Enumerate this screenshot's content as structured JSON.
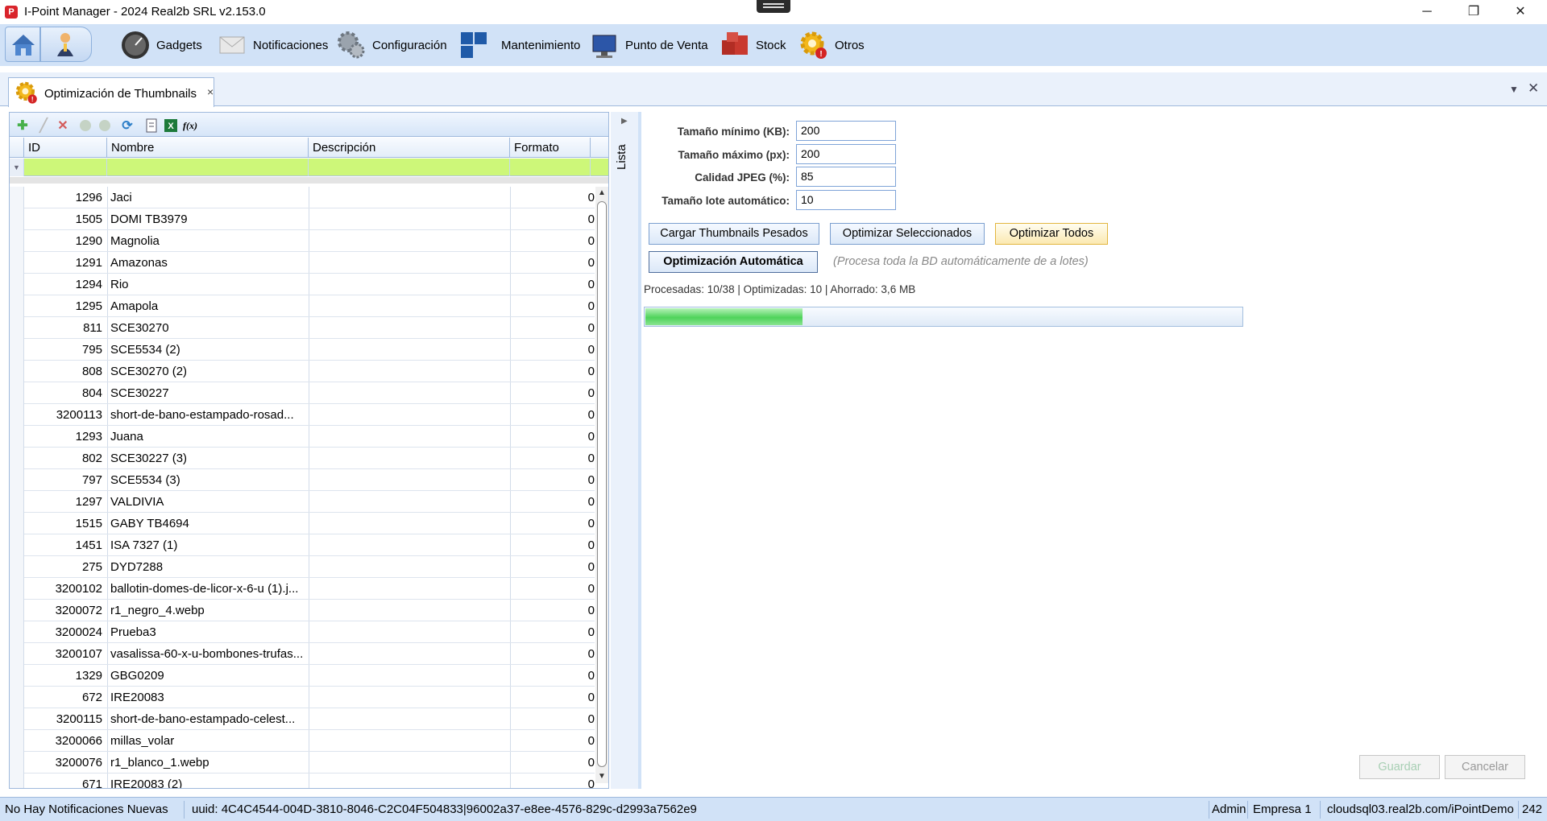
{
  "window": {
    "title": "I-Point Manager - 2024 Real2b SRL v2.153.0",
    "app_icon_letter": "P",
    "minimize": "─",
    "restore": "❐",
    "close": "✕"
  },
  "ribbon": {
    "items": [
      {
        "label": "Gadgets",
        "icon": "gauge-icon"
      },
      {
        "label": "Notificaciones",
        "icon": "envelope-icon"
      },
      {
        "label": "Configuración",
        "icon": "gears-icon"
      },
      {
        "label": "Mantenimiento",
        "icon": "tiles-icon"
      },
      {
        "label": "Punto de Venta",
        "icon": "monitor-icon"
      },
      {
        "label": "Stock",
        "icon": "boxes-icon"
      },
      {
        "label": "Otros",
        "icon": "gear-alert-icon"
      }
    ]
  },
  "tab": {
    "label": "Optimización de Thumbnails",
    "close": "×",
    "menu_glyph": "▼",
    "close_glyph": "✕"
  },
  "grid": {
    "toolbar": [
      "add-icon",
      "edit-icon",
      "delete-icon",
      "prev-icon",
      "next-icon",
      "refresh-icon",
      "export-icon",
      "excel-icon",
      "formula-icon"
    ],
    "columns": {
      "id": "ID",
      "name": "Nombre",
      "description": "Descripción",
      "format": "Formato"
    },
    "rows": [
      {
        "id": "1296",
        "name": "Jaci",
        "desc": "",
        "fmt": "0"
      },
      {
        "id": "1505",
        "name": "DOMI TB3979",
        "desc": "",
        "fmt": "0"
      },
      {
        "id": "1290",
        "name": "Magnolia",
        "desc": "",
        "fmt": "0"
      },
      {
        "id": "1291",
        "name": "Amazonas",
        "desc": "",
        "fmt": "0"
      },
      {
        "id": "1294",
        "name": "Rio",
        "desc": "",
        "fmt": "0"
      },
      {
        "id": "1295",
        "name": "Amapola",
        "desc": "",
        "fmt": "0"
      },
      {
        "id": "811",
        "name": "SCE30270",
        "desc": "",
        "fmt": "0"
      },
      {
        "id": "795",
        "name": "SCE5534 (2)",
        "desc": "",
        "fmt": "0"
      },
      {
        "id": "808",
        "name": "SCE30270 (2)",
        "desc": "",
        "fmt": "0"
      },
      {
        "id": "804",
        "name": "SCE30227",
        "desc": "",
        "fmt": "0"
      },
      {
        "id": "3200113",
        "name": "short-de-bano-estampado-rosad...",
        "desc": "",
        "fmt": "0"
      },
      {
        "id": "1293",
        "name": "Juana",
        "desc": "",
        "fmt": "0"
      },
      {
        "id": "802",
        "name": "SCE30227 (3)",
        "desc": "",
        "fmt": "0"
      },
      {
        "id": "797",
        "name": "SCE5534 (3)",
        "desc": "",
        "fmt": "0"
      },
      {
        "id": "1297",
        "name": "VALDIVIA",
        "desc": "",
        "fmt": "0"
      },
      {
        "id": "1515",
        "name": "GABY TB4694",
        "desc": "",
        "fmt": "0"
      },
      {
        "id": "1451",
        "name": "ISA 7327 (1)",
        "desc": "",
        "fmt": "0"
      },
      {
        "id": "275",
        "name": "DYD7288",
        "desc": "",
        "fmt": "0"
      },
      {
        "id": "3200102",
        "name": "ballotin-domes-de-licor-x-6-u (1).j...",
        "desc": "",
        "fmt": "0"
      },
      {
        "id": "3200072",
        "name": "r1_negro_4.webp",
        "desc": "",
        "fmt": "0"
      },
      {
        "id": "3200024",
        "name": "Prueba3",
        "desc": "",
        "fmt": "0"
      },
      {
        "id": "3200107",
        "name": "vasalissa-60-x-u-bombones-trufas...",
        "desc": "",
        "fmt": "0"
      },
      {
        "id": "1329",
        "name": "GBG0209",
        "desc": "",
        "fmt": "0"
      },
      {
        "id": "672",
        "name": "IRE20083",
        "desc": "",
        "fmt": "0"
      },
      {
        "id": "3200115",
        "name": "short-de-bano-estampado-celest...",
        "desc": "",
        "fmt": "0"
      },
      {
        "id": "3200066",
        "name": "millas_volar",
        "desc": "",
        "fmt": "0"
      },
      {
        "id": "3200076",
        "name": "r1_blanco_1.webp",
        "desc": "",
        "fmt": "0"
      },
      {
        "id": "671",
        "name": "IRE20083 (2)",
        "desc": "",
        "fmt": "0"
      }
    ]
  },
  "side_pane": {
    "label": "Lista",
    "arrow": "▶"
  },
  "form": {
    "min_size_label": "Tamaño mínimo (KB):",
    "min_size_value": "200",
    "max_size_label": "Tamaño máximo (px):",
    "max_size_value": "200",
    "jpeg_quality_label": "Calidad JPEG (%):",
    "jpeg_quality_value": "85",
    "batch_size_label": "Tamaño lote automático:",
    "batch_size_value": "10",
    "load_button": "Cargar Thumbnails Pesados",
    "optimize_selected_button": "Optimizar Seleccionados",
    "optimize_all_button": "Optimizar Todos",
    "auto_button": "Optimización Automática",
    "auto_hint": "(Procesa toda la BD automáticamente de a lotes)",
    "status": "Procesadas: 10/38 | Optimizadas: 10 | Ahorrado: 3,6 MB",
    "progress_fraction": 0.263,
    "save_button": "Guardar",
    "cancel_button": "Cancelar"
  },
  "statusbar": {
    "notifications": "No Hay Notificaciones Nuevas",
    "uuid": "uuid: 4C4C4544-004D-3810-8046-C2C04F504833|96002a37-e8ee-4576-829c-d2993a7562e9",
    "user": "Admin",
    "company": "Empresa 1",
    "server": "cloudsql03.real2b.com/iPointDemo",
    "extra": "242"
  },
  "colors": {
    "ribbon_bg": "#d1e2f7",
    "filter_row": "#cdf779",
    "progress_fill": "#4ed35a",
    "accent_border": "#9fb9dc"
  }
}
